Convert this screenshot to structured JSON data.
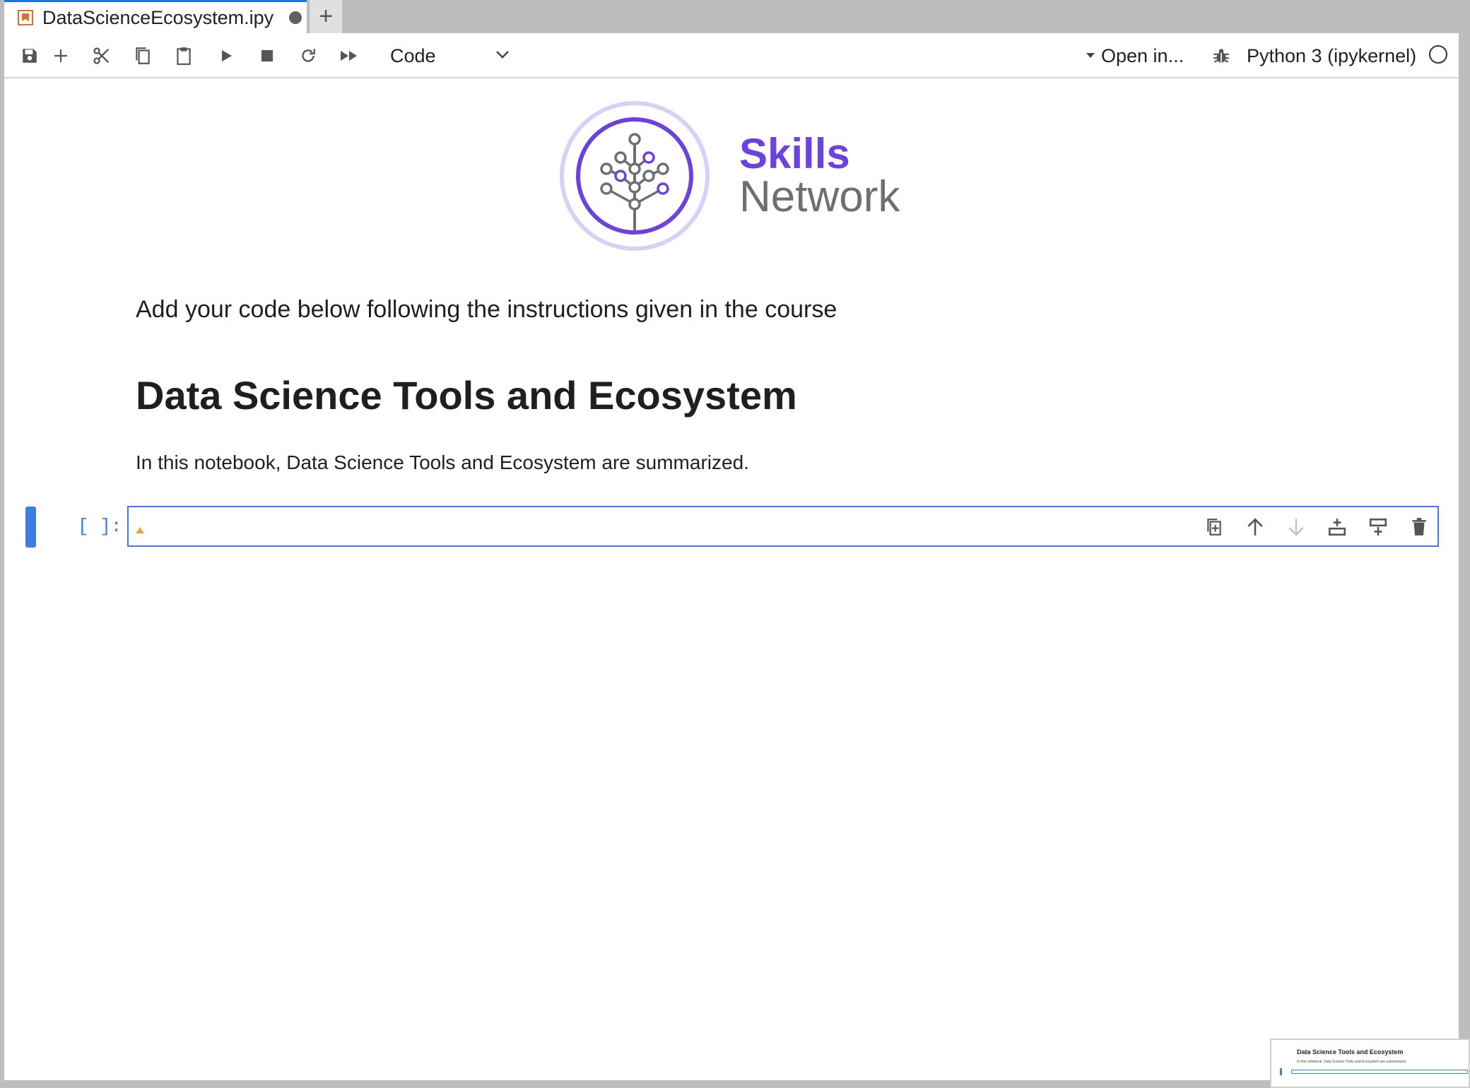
{
  "tabs": {
    "active": {
      "title": "DataScienceEcosystem.ipy"
    },
    "new_tab_label": "+"
  },
  "toolbar": {
    "buttons": [
      "save-icon",
      "add-cell-icon",
      "cut-icon",
      "copy-icon",
      "paste-icon",
      "run-icon",
      "stop-icon",
      "restart-icon",
      "run-all-icon"
    ],
    "cell_type": "Code",
    "open_in": "Open in...",
    "kernel_name": "Python 3 (ipykernel)"
  },
  "logo": {
    "line1": "Skills",
    "line2": "Network",
    "colors": {
      "primary": "#6b42e0",
      "ring": "#d9d0f7",
      "text_grey": "#6d6f74"
    }
  },
  "notebook": {
    "intro_text": "Add your code below following the instructions given in the course",
    "heading": "Data Science Tools and Ecosystem",
    "summary_text": "In this notebook, Data Science Tools and Ecosystem are summarized.",
    "code_cell": {
      "prompt": "[ ]:",
      "value": "",
      "tools": [
        "duplicate-cell-icon",
        "move-up-icon",
        "move-down-icon",
        "insert-above-icon",
        "insert-below-icon",
        "delete-cell-icon"
      ]
    }
  },
  "thumbnail": {
    "title": "Data Science Tools and Ecosystem",
    "text": "In this notebook, Data Science Tools and Ecosystem are summarized."
  },
  "accent": "#3b7de0"
}
